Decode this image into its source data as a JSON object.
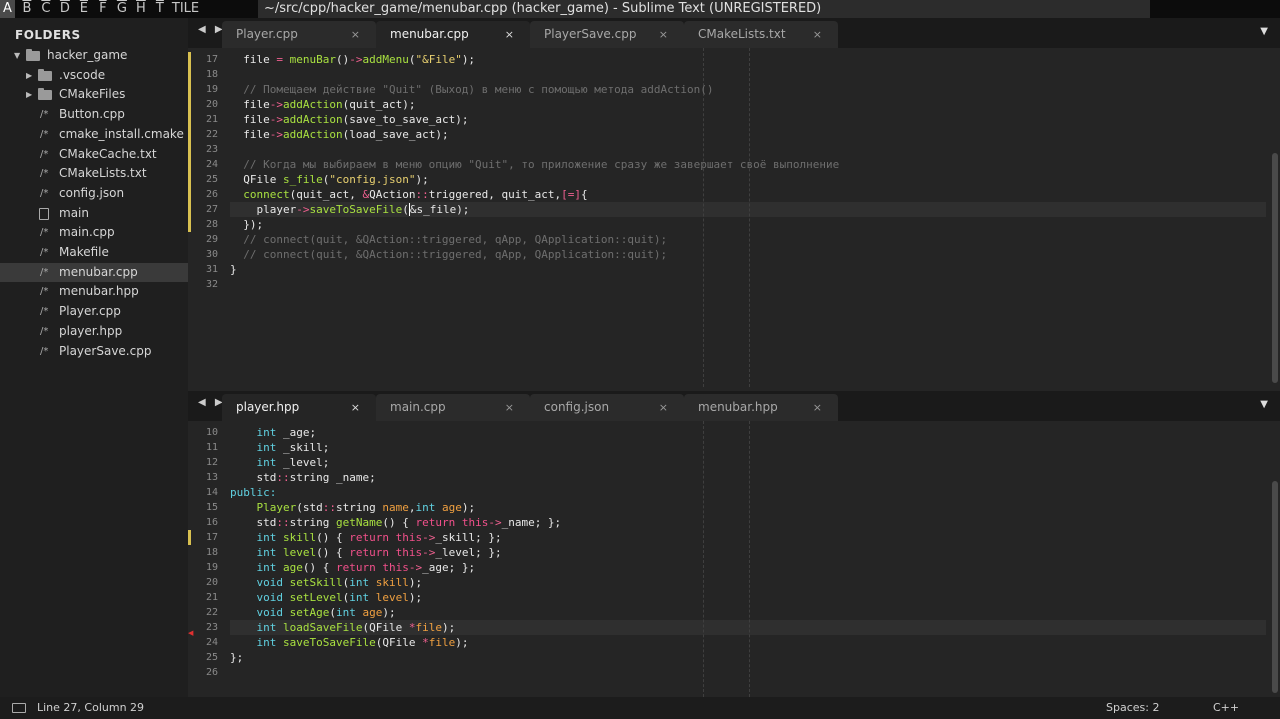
{
  "wm": {
    "letters": [
      "A",
      "B",
      "C",
      "D",
      "E",
      "F",
      "G",
      "H",
      "T",
      "TILE"
    ],
    "active_index": 0,
    "title": "~/src/cpp/hacker_game/menubar.cpp (hacker_game) - Sublime Text (UNREGISTERED)"
  },
  "sidebar": {
    "title": "FOLDERS",
    "items": [
      {
        "label": "hacker_game",
        "kind": "folder",
        "level": 0,
        "expanded": true
      },
      {
        "label": ".vscode",
        "kind": "folder",
        "level": 1,
        "expanded": false
      },
      {
        "label": "CMakeFiles",
        "kind": "folder",
        "level": 1,
        "expanded": false
      },
      {
        "label": "Button.cpp",
        "kind": "code",
        "level": 1
      },
      {
        "label": "cmake_install.cmake",
        "kind": "code",
        "level": 1
      },
      {
        "label": "CMakeCache.txt",
        "kind": "code",
        "level": 1
      },
      {
        "label": "CMakeLists.txt",
        "kind": "code",
        "level": 1
      },
      {
        "label": "config.json",
        "kind": "code",
        "level": 1
      },
      {
        "label": "main",
        "kind": "file",
        "level": 1
      },
      {
        "label": "main.cpp",
        "kind": "code",
        "level": 1
      },
      {
        "label": "Makefile",
        "kind": "code",
        "level": 1
      },
      {
        "label": "menubar.cpp",
        "kind": "code",
        "level": 1,
        "selected": true
      },
      {
        "label": "menubar.hpp",
        "kind": "code",
        "level": 1
      },
      {
        "label": "Player.cpp",
        "kind": "code",
        "level": 1
      },
      {
        "label": "player.hpp",
        "kind": "code",
        "level": 1
      },
      {
        "label": "PlayerSave.cpp",
        "kind": "code",
        "level": 1
      }
    ]
  },
  "top_pane": {
    "tabs": [
      {
        "label": "Player.cpp",
        "close": "×",
        "active": false
      },
      {
        "label": "menubar.cpp",
        "close": "×",
        "active": true
      },
      {
        "label": "PlayerSave.cpp",
        "close": "×",
        "active": false
      },
      {
        "label": "CMakeLists.txt",
        "close": "×",
        "active": false
      }
    ],
    "nav": "◀ ▶",
    "menu": "▼",
    "current_line": 27,
    "modified_lines": [
      17,
      18,
      19,
      20,
      21,
      22,
      23,
      24,
      25,
      26,
      27,
      28
    ],
    "lines": [
      {
        "n": 17,
        "tokens": [
          [
            "  file ",
            ""
          ],
          [
            "=",
            "op"
          ],
          [
            " ",
            ""
          ],
          [
            "menuBar",
            "f"
          ],
          [
            "()",
            ""
          ],
          [
            "->",
            "op"
          ],
          [
            "addMenu",
            "f"
          ],
          [
            "(",
            ""
          ],
          [
            "\"&File\"",
            "s"
          ],
          [
            ");",
            ""
          ]
        ]
      },
      {
        "n": 18,
        "tokens": []
      },
      {
        "n": 19,
        "tokens": [
          [
            "  // Помещаем действие \"Quit\" (Выход) в меню с помощью метода addAction()",
            "c"
          ]
        ]
      },
      {
        "n": 20,
        "tokens": [
          [
            "  file",
            ""
          ],
          [
            "->",
            "op"
          ],
          [
            "addAction",
            "f"
          ],
          [
            "(quit_act);",
            ""
          ]
        ]
      },
      {
        "n": 21,
        "tokens": [
          [
            "  file",
            ""
          ],
          [
            "->",
            "op"
          ],
          [
            "addAction",
            "f"
          ],
          [
            "(save_to_save_act);",
            ""
          ]
        ]
      },
      {
        "n": 22,
        "tokens": [
          [
            "  file",
            ""
          ],
          [
            "->",
            "op"
          ],
          [
            "addAction",
            "f"
          ],
          [
            "(load_save_act);",
            ""
          ]
        ]
      },
      {
        "n": 23,
        "tokens": []
      },
      {
        "n": 24,
        "tokens": [
          [
            "  // Когда мы выбираем в меню опцию \"Quit\", то приложение сразу же завершает своё выполнение",
            "c"
          ]
        ]
      },
      {
        "n": 25,
        "tokens": [
          [
            "  QFile ",
            ""
          ],
          [
            "s_file",
            "f"
          ],
          [
            "(",
            ""
          ],
          [
            "\"config.json\"",
            "s"
          ],
          [
            ");",
            ""
          ]
        ]
      },
      {
        "n": 26,
        "tokens": [
          [
            "  ",
            ""
          ],
          [
            "connect",
            "f"
          ],
          [
            "(quit_act, ",
            ""
          ],
          [
            "&",
            "op"
          ],
          [
            "QAction",
            ""
          ],
          [
            "::",
            "op"
          ],
          [
            "triggered, quit_act,",
            ""
          ],
          [
            "[=]",
            "op"
          ],
          [
            "{",
            ""
          ]
        ]
      },
      {
        "n": 27,
        "tokens": [
          [
            "    player",
            ""
          ],
          [
            "->",
            "op"
          ],
          [
            "saveToSaveFile",
            "f"
          ],
          [
            "(",
            ""
          ],
          [
            "&",
            "cur"
          ],
          [
            "s_file);",
            ""
          ]
        ]
      },
      {
        "n": 28,
        "tokens": [
          [
            "  });",
            ""
          ]
        ]
      },
      {
        "n": 29,
        "tokens": [
          [
            "  // connect(quit, &QAction::triggered, qApp, QApplication::quit);",
            "c"
          ]
        ]
      },
      {
        "n": 30,
        "tokens": [
          [
            "  // connect(quit, &QAction::triggered, qApp, QApplication::quit);",
            "c"
          ]
        ]
      },
      {
        "n": 31,
        "tokens": [
          [
            "}",
            ""
          ]
        ]
      },
      {
        "n": 32,
        "tokens": []
      }
    ]
  },
  "bottom_pane": {
    "tabs": [
      {
        "label": "player.hpp",
        "close": "×",
        "active": true
      },
      {
        "label": "main.cpp",
        "close": "×",
        "active": false
      },
      {
        "label": "config.json",
        "close": "×",
        "active": false
      },
      {
        "label": "menubar.hpp",
        "close": "×",
        "active": false
      }
    ],
    "nav": "◀ ▶",
    "menu": "▼",
    "current_line": 23,
    "modified_lines": [
      17
    ],
    "error_line": 24,
    "lines": [
      {
        "n": 10,
        "tokens": [
          [
            "    ",
            ""
          ],
          [
            "int",
            "t"
          ],
          [
            " _age;",
            ""
          ]
        ]
      },
      {
        "n": 11,
        "tokens": [
          [
            "    ",
            ""
          ],
          [
            "int",
            "t"
          ],
          [
            " _skill;",
            ""
          ]
        ]
      },
      {
        "n": 12,
        "tokens": [
          [
            "    ",
            ""
          ],
          [
            "int",
            "t"
          ],
          [
            " _level;",
            ""
          ]
        ]
      },
      {
        "n": 13,
        "tokens": [
          [
            "    std",
            ""
          ],
          [
            "::",
            "op"
          ],
          [
            "string _name;",
            ""
          ]
        ]
      },
      {
        "n": 14,
        "tokens": [
          [
            "public:",
            "t"
          ]
        ]
      },
      {
        "n": 15,
        "tokens": [
          [
            "    ",
            ""
          ],
          [
            "Player",
            "f"
          ],
          [
            "(std",
            ""
          ],
          [
            "::",
            "op"
          ],
          [
            "string ",
            ""
          ],
          [
            "name",
            "p"
          ],
          [
            ",",
            ""
          ],
          [
            "int",
            "t"
          ],
          [
            " ",
            ""
          ],
          [
            "age",
            "p"
          ],
          [
            ");",
            ""
          ]
        ]
      },
      {
        "n": 16,
        "tokens": [
          [
            "    std",
            ""
          ],
          [
            "::",
            "op"
          ],
          [
            "string ",
            ""
          ],
          [
            "getName",
            "f"
          ],
          [
            "() { ",
            ""
          ],
          [
            "return",
            "k"
          ],
          [
            " ",
            ""
          ],
          [
            "this",
            "k"
          ],
          [
            "->",
            "op"
          ],
          [
            "_name; };",
            ""
          ]
        ]
      },
      {
        "n": 17,
        "tokens": [
          [
            "    ",
            ""
          ],
          [
            "int",
            "t"
          ],
          [
            " ",
            ""
          ],
          [
            "skill",
            "f"
          ],
          [
            "() { ",
            ""
          ],
          [
            "return",
            "k"
          ],
          [
            " ",
            ""
          ],
          [
            "this",
            "k"
          ],
          [
            "->",
            "op"
          ],
          [
            "_skill; };",
            ""
          ]
        ]
      },
      {
        "n": 18,
        "tokens": [
          [
            "    ",
            ""
          ],
          [
            "int",
            "t"
          ],
          [
            " ",
            ""
          ],
          [
            "level",
            "f"
          ],
          [
            "() { ",
            ""
          ],
          [
            "return",
            "k"
          ],
          [
            " ",
            ""
          ],
          [
            "this",
            "k"
          ],
          [
            "->",
            "op"
          ],
          [
            "_level; };",
            ""
          ]
        ]
      },
      {
        "n": 19,
        "tokens": [
          [
            "    ",
            ""
          ],
          [
            "int",
            "t"
          ],
          [
            " ",
            ""
          ],
          [
            "age",
            "f"
          ],
          [
            "() { ",
            ""
          ],
          [
            "return",
            "k"
          ],
          [
            " ",
            ""
          ],
          [
            "this",
            "k"
          ],
          [
            "->",
            "op"
          ],
          [
            "_age; };",
            ""
          ]
        ]
      },
      {
        "n": 20,
        "tokens": [
          [
            "    ",
            ""
          ],
          [
            "void",
            "t"
          ],
          [
            " ",
            ""
          ],
          [
            "setSkill",
            "f"
          ],
          [
            "(",
            ""
          ],
          [
            "int",
            "t"
          ],
          [
            " ",
            ""
          ],
          [
            "skill",
            "p"
          ],
          [
            ");",
            ""
          ]
        ]
      },
      {
        "n": 21,
        "tokens": [
          [
            "    ",
            ""
          ],
          [
            "void",
            "t"
          ],
          [
            " ",
            ""
          ],
          [
            "setLevel",
            "f"
          ],
          [
            "(",
            ""
          ],
          [
            "int",
            "t"
          ],
          [
            " ",
            ""
          ],
          [
            "level",
            "p"
          ],
          [
            ");",
            ""
          ]
        ]
      },
      {
        "n": 22,
        "tokens": [
          [
            "    ",
            ""
          ],
          [
            "void",
            "t"
          ],
          [
            " ",
            ""
          ],
          [
            "setAge",
            "f"
          ],
          [
            "(",
            ""
          ],
          [
            "int",
            "t"
          ],
          [
            " ",
            ""
          ],
          [
            "age",
            "p"
          ],
          [
            ");",
            ""
          ]
        ]
      },
      {
        "n": 23,
        "tokens": [
          [
            "    ",
            ""
          ],
          [
            "int",
            "t"
          ],
          [
            " ",
            ""
          ],
          [
            "loadSaveFile",
            "f"
          ],
          [
            "(QFile ",
            ""
          ],
          [
            "*",
            "op"
          ],
          [
            "file",
            "p"
          ],
          [
            ");",
            ""
          ]
        ]
      },
      {
        "n": 24,
        "tokens": [
          [
            "    ",
            ""
          ],
          [
            "int",
            "t"
          ],
          [
            " ",
            ""
          ],
          [
            "saveToSaveFile",
            "f"
          ],
          [
            "(QFile ",
            ""
          ],
          [
            "*",
            "op"
          ],
          [
            "file",
            "p"
          ],
          [
            ");",
            ""
          ]
        ]
      },
      {
        "n": 25,
        "tokens": [
          [
            "};",
            ""
          ]
        ]
      },
      {
        "n": 26,
        "tokens": []
      }
    ]
  },
  "status": {
    "position": "Line 27, Column 29",
    "spaces": "Spaces: 2",
    "syntax": "C++"
  }
}
